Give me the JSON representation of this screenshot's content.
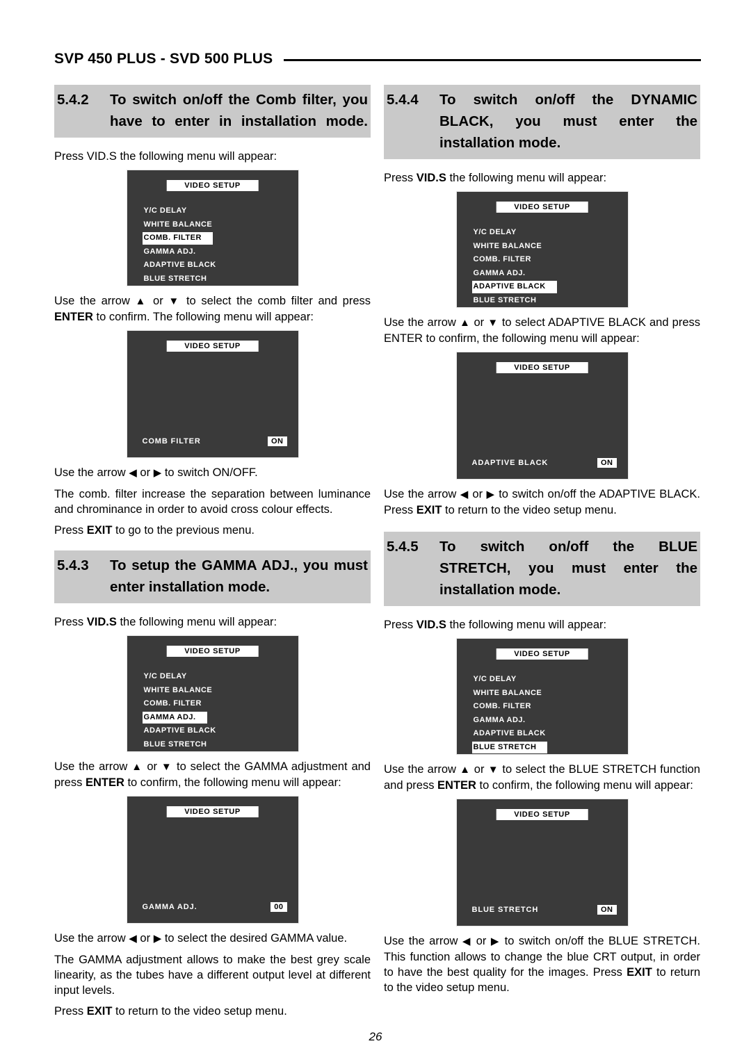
{
  "running_head": {
    "title": "SVP 450 PLUS - SVD 500 PLUS"
  },
  "page_number": "26",
  "colors": {
    "heading_background": "#c9c9c9",
    "osd_background": "#3a3a3a",
    "osd_text": "#ffffff",
    "osd_highlight": "#ffffff"
  },
  "osd_menu_items": {
    "yc_delay": "Y/C DELAY",
    "white_balance": "WHITE BALANCE",
    "comb_filter": "COMB. FILTER",
    "gamma_adj": "GAMMA ADJ.",
    "adaptive_black": "ADAPTIVE  BLACK",
    "blue_stretch": "BLUE STRETCH"
  },
  "left_column": {
    "section_542": {
      "number": "5.4.2",
      "line1": "To switch on/off the Comb filter, you",
      "line2": "have to enter in installation mode.",
      "intro": "Press VID.S the following menu will appear:",
      "menu1": {
        "title": "VIDEO SETUP",
        "items": [
          {
            "label": "Y/C DELAY",
            "selected": false
          },
          {
            "label": "WHITE BALANCE",
            "selected": false
          },
          {
            "label": "COMB. FILTER",
            "selected": true
          },
          {
            "label": "GAMMA ADJ.",
            "selected": false
          },
          {
            "label": "ADAPTIVE BLACK",
            "selected": false
          },
          {
            "label": "BLUE STRETCH",
            "selected": false
          }
        ]
      },
      "para_select_pre": "Use the arrow ",
      "para_select_mid": " or ",
      "para_select_post": " to select the comb filter and press ",
      "para_select_bold": "ENTER",
      "para_select_tail": " to confirm. The following menu will appear:",
      "menu2": {
        "title": "VIDEO  SETUP",
        "value_label": "COMB   FILTER",
        "value": "ON"
      },
      "para_switch": "to switch ON/OFF.",
      "para_switch_pre": "Use the arrow ",
      "para_desc": "The comb. filter increase the separation between luminance and chrominance in order to avoid cross colour effects.",
      "para_exit_pre": "Press ",
      "para_exit_bold": "EXIT",
      "para_exit_post": " to go to the previous menu."
    },
    "section_543": {
      "number": "5.4.3",
      "line1": "To setup the GAMMA ADJ., you must",
      "line2": "enter installation mode.",
      "intro_pre": "Press ",
      "intro_bold": "VID.S",
      "intro_post": " the following menu will appear:",
      "menu1": {
        "title": "VIDEO  SETUP",
        "items": [
          {
            "label": "Y/C DELAY",
            "selected": false
          },
          {
            "label": "WHITE BALANCE",
            "selected": false
          },
          {
            "label": "COMB. FILTER",
            "selected": false
          },
          {
            "label": "GAMMA ADJ.",
            "selected": true
          },
          {
            "label": "ADAPTIVE  BLACK",
            "selected": false
          },
          {
            "label": "BLUE STRETCH",
            "selected": false
          }
        ]
      },
      "para_select_pre": "Use the arrow ",
      "para_select_mid": " or ",
      "para_select_post": " to select the GAMMA adjustment and press ",
      "para_select_bold": "ENTER",
      "para_select_tail": " to confirm, the following menu will appear:",
      "menu2": {
        "title": "VIDEO  SETUP",
        "value_label": "GAMMA ADJ.",
        "value": "00"
      },
      "para_value_pre": "Use the arrow ",
      "para_value_post": " to select the desired GAMMA value.",
      "para_desc": "The GAMMA adjustment allows to make the best grey scale linearity, as the tubes have a different output level at different input levels.",
      "para_exit_pre": "Press ",
      "para_exit_bold": "EXIT",
      "para_exit_post": " to return to the video setup menu."
    }
  },
  "right_column": {
    "section_544": {
      "number": "5.4.4",
      "line1": "To switch on/off the DYNAMIC",
      "line2": "BLACK, you must enter the",
      "line3": "installation mode.",
      "intro_pre": "Press ",
      "intro_bold": "VID.S",
      "intro_post": " the following menu will appear:",
      "menu1": {
        "title": "VIDEO  SETUP",
        "items": [
          {
            "label": "Y/C DELAY",
            "selected": false
          },
          {
            "label": "WHITE BALANCE",
            "selected": false
          },
          {
            "label": "COMB. FILTER",
            "selected": false
          },
          {
            "label": "GAMMA ADJ.",
            "selected": false
          },
          {
            "label": "ADAPTIVE  BLACK",
            "selected": true
          },
          {
            "label": "BLUE STRETCH",
            "selected": false
          }
        ]
      },
      "para_select_pre": "Use the arrow ",
      "para_select_mid": " or ",
      "para_select_post": " to select ADAPTIVE BLACK and press ENTER to confirm, the following menu will appear:",
      "menu2": {
        "title": "VIDEO  SETUP",
        "value_label": "ADAPTIVE  BLACK",
        "value": "ON"
      },
      "para_switch_pre": "Use the arrow ",
      "para_switch_mid": " or ",
      "para_switch_post": " to switch on/off the ADAPTIVE BLACK. Press ",
      "para_switch_bold": "EXIT",
      "para_switch_tail": " to return to the video setup menu."
    },
    "section_545": {
      "number": "5.4.5",
      "line1": "To switch on/off the BLUE",
      "line2": "STRETCH, you must enter the",
      "line3": "installation mode.",
      "intro_pre": "Press ",
      "intro_bold": "VID.S",
      "intro_post": " the following menu will appear:",
      "menu1": {
        "title": "VIDEO  SETUP",
        "items": [
          {
            "label": "Y/C DELAY",
            "selected": false
          },
          {
            "label": "WHITE BALANCE",
            "selected": false
          },
          {
            "label": "COMB. FILTER",
            "selected": false
          },
          {
            "label": "GAMMA ADJ.",
            "selected": false
          },
          {
            "label": "ADAPTIVE  BLACK",
            "selected": false
          },
          {
            "label": "BLUE STRETCH",
            "selected": true
          }
        ]
      },
      "para_select_pre": "Use the arrow ",
      "para_select_mid": " or ",
      "para_select_post": " to select the BLUE STRETCH function and press ",
      "para_select_bold": "ENTER",
      "para_select_tail": " to confirm, the following menu will appear:",
      "menu2": {
        "title": "VIDEO  SETUP",
        "value_label": "BLUE STRETCH",
        "value": "ON"
      },
      "para_switch_pre": "Use the arrow ",
      "para_switch_mid": " or ",
      "para_switch_post": " to switch on/off the BLUE STRETCH. This function allows to change the blue CRT output, in order to have the best quality for the images. Press ",
      "para_switch_bold": "EXIT",
      "para_switch_tail": " to return to the video setup menu."
    }
  },
  "icons": {
    "arrow_up": "▲",
    "arrow_down": "▼",
    "arrow_left": "◀",
    "arrow_right": "▶"
  }
}
